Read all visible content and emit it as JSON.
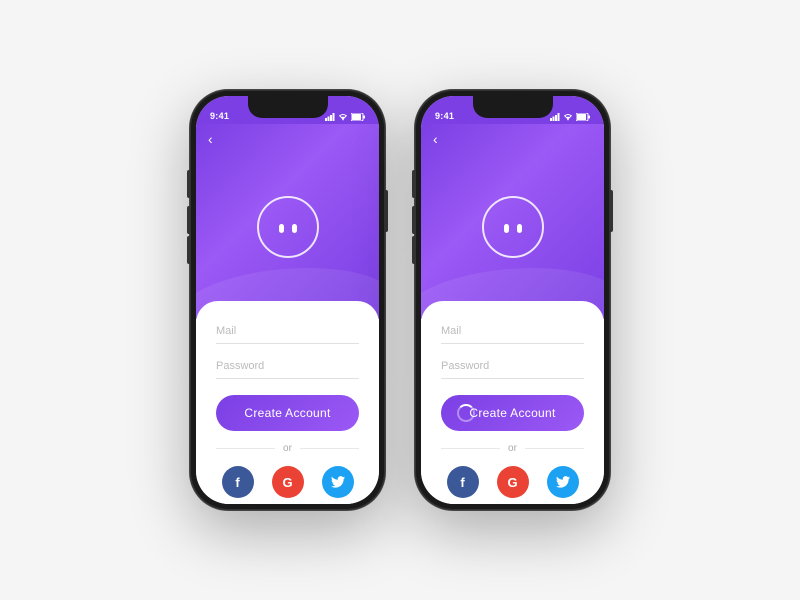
{
  "phones": [
    {
      "id": "phone-1",
      "status": {
        "time": "9:41",
        "signal_icon": "signal",
        "wifi_icon": "wifi",
        "battery_icon": "battery"
      },
      "header": {
        "back_label": "‹",
        "logo_alt": "app-logo"
      },
      "form": {
        "mail_placeholder": "Mail",
        "password_placeholder": "Password",
        "create_account_label": "Create Account"
      },
      "divider": {
        "or_label": "or"
      },
      "social": [
        {
          "name": "facebook",
          "label": "f"
        },
        {
          "name": "google",
          "label": "G"
        },
        {
          "name": "twitter",
          "label": "t"
        }
      ]
    },
    {
      "id": "phone-2",
      "status": {
        "time": "9:41",
        "signal_icon": "signal",
        "wifi_icon": "wifi",
        "battery_icon": "battery"
      },
      "header": {
        "back_label": "‹",
        "logo_alt": "app-logo"
      },
      "form": {
        "mail_placeholder": "Mail",
        "password_placeholder": "Password",
        "create_account_label": "Create Account"
      },
      "divider": {
        "or_label": "or"
      },
      "social": [
        {
          "name": "facebook",
          "label": "f"
        },
        {
          "name": "google",
          "label": "G"
        },
        {
          "name": "twitter",
          "label": "t"
        }
      ]
    }
  ],
  "colors": {
    "accent": "#7b3fe4",
    "accent_light": "#9b59f5",
    "facebook": "#3b5998",
    "google": "#ea4335",
    "twitter": "#1da1f2"
  }
}
